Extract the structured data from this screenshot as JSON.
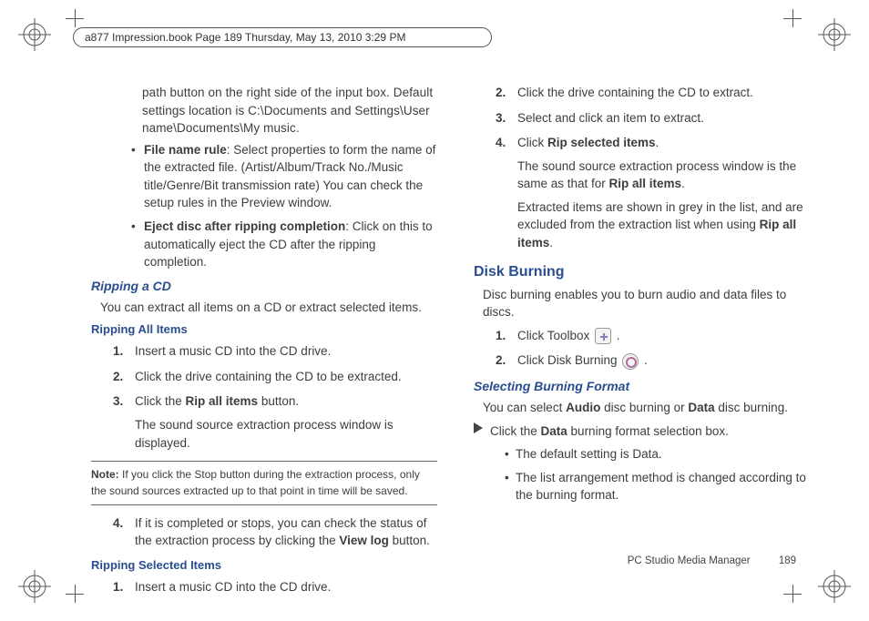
{
  "header": {
    "stamp": "a877 Impression.book  Page 189  Thursday, May 13, 2010  3:29 PM"
  },
  "left": {
    "cont": "path button on the right side of the input box. Default settings location is C:\\Documents and Settings\\User name\\Documents\\My music.",
    "bullets": [
      {
        "term": "File name rule",
        "rest": ": Select properties to form the name of the extracted file. (Artist/Album/Track No./Music title/Genre/Bit transmission rate) You can check the setup rules in the Preview window."
      },
      {
        "term": "Eject disc after ripping completion",
        "rest": ": Click on this to automatically eject the CD after the ripping completion."
      }
    ],
    "h_rip_cd": "Ripping a CD",
    "rip_cd_p": "You can extract all items on a CD or extract selected items.",
    "h_rip_all": "Ripping All Items",
    "steps_all": [
      {
        "n": "1.",
        "t": "Insert a music CD into the CD drive."
      },
      {
        "n": "2.",
        "t": "Click the drive containing the CD to be extracted."
      },
      {
        "n": "3.",
        "t_pre": "Click the ",
        "t_bold": "Rip all items",
        "t_post": " button.",
        "p2": "The sound source extraction process window is displayed."
      }
    ],
    "note_label": "Note:",
    "note_text": " If you click the Stop button during the extraction process, only the sound sources extracted up to that point in time will be saved.",
    "steps_all_4": {
      "n": "4.",
      "t_pre": "If it is completed or stops, you can check the status of the extraction process by clicking the ",
      "t_bold": "View log",
      "t_post": " button."
    },
    "h_rip_sel": "Ripping Selected Items",
    "steps_sel": [
      {
        "n": "1.",
        "t": "Insert a music CD into the CD drive."
      }
    ]
  },
  "right": {
    "steps_sel": [
      {
        "n": "2.",
        "t": "Click the drive containing the CD to extract."
      },
      {
        "n": "3.",
        "t": "Select and click an item to extract."
      },
      {
        "n": "4.",
        "t_pre": "Click ",
        "t_bold": "Rip selected items",
        "t_post": ".",
        "p2_pre": "The sound source extraction process window is the same as that for ",
        "p2_bold": "Rip all items",
        "p2_post": ".",
        "p3_pre": "Extracted items are shown in grey in the list, and are excluded from the extraction list when using ",
        "p3_bold": "Rip all items",
        "p3_post": "."
      }
    ],
    "h_burn": "Disk Burning",
    "burn_p": "Disc burning enables you to burn audio and data files to discs.",
    "steps_burn": [
      {
        "n": "1.",
        "t": "Click Toolbox ",
        "icon": "tool",
        "tail": " ."
      },
      {
        "n": "2.",
        "t": "Click Disk Burning ",
        "icon": "burn",
        "tail": " ."
      }
    ],
    "h_sel_fmt": "Selecting Burning Format",
    "fmt_p_pre": "You can select ",
    "fmt_b1": "Audio",
    "fmt_mid": " disc burning or ",
    "fmt_b2": "Data",
    "fmt_post": " disc burning.",
    "arrow_pre": "Click the ",
    "arrow_bold": "Data",
    "arrow_post": " burning format selection box.",
    "sub": [
      "The default setting is Data.",
      "The list arrangement method is changed according to the burning format."
    ]
  },
  "footer": {
    "title": "PC Studio Media Manager",
    "page": "189"
  }
}
